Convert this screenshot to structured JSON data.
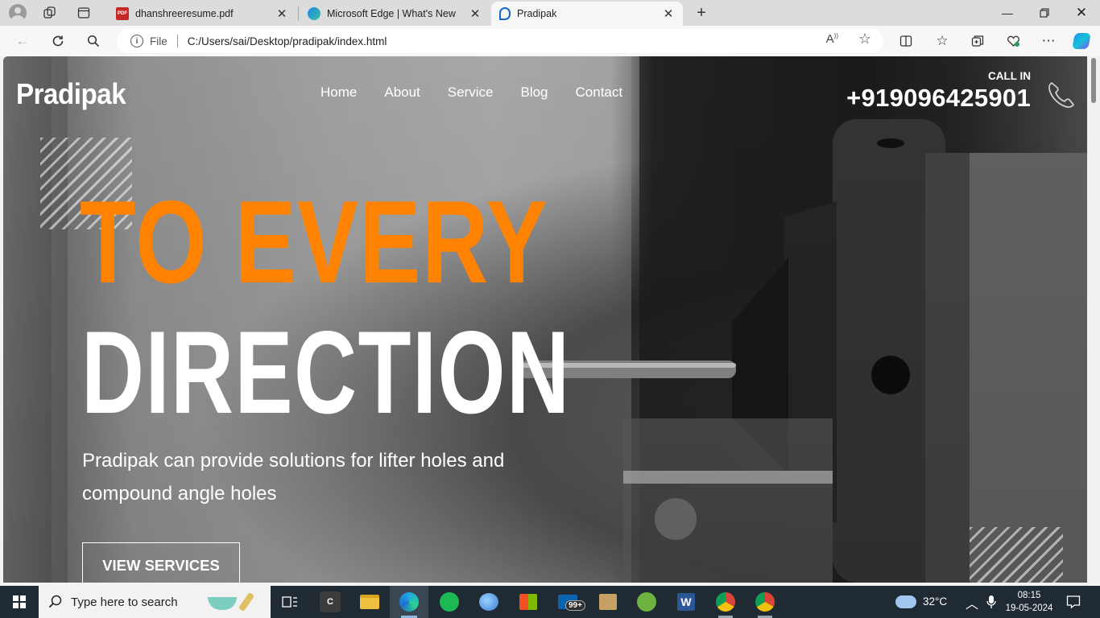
{
  "browser": {
    "tabs": [
      {
        "title": "dhanshreeresume.pdf",
        "favicon": "pdf-icon",
        "active": false
      },
      {
        "title": "Microsoft Edge | What's New",
        "favicon": "edge-icon",
        "active": false
      },
      {
        "title": "Pradipak",
        "favicon": "pradipak-icon",
        "active": true
      }
    ],
    "address": {
      "scheme_label": "File",
      "url": "C:/Users/sai/Desktop/pradipak/index.html"
    }
  },
  "site": {
    "logo": "Pradipak",
    "nav": [
      "Home",
      "About",
      "Service",
      "Blog",
      "Contact"
    ],
    "call_label": "CALL IN",
    "call_number": "+919096425901",
    "hero": {
      "line1": "TO EVERY",
      "line2": "DIRECTION",
      "subtitle": "Pradipak can provide solutions for lifter holes and compound angle holes",
      "button": "VIEW SERVICES"
    },
    "colors": {
      "accent": "#ff8300",
      "text": "#ffffff"
    }
  },
  "taskbar": {
    "search_placeholder": "Type here to search",
    "weather": "32°C",
    "badge": "99+",
    "time": "08:15",
    "date": "19-05-2024",
    "app_c_label": "C",
    "word_label": "W"
  }
}
